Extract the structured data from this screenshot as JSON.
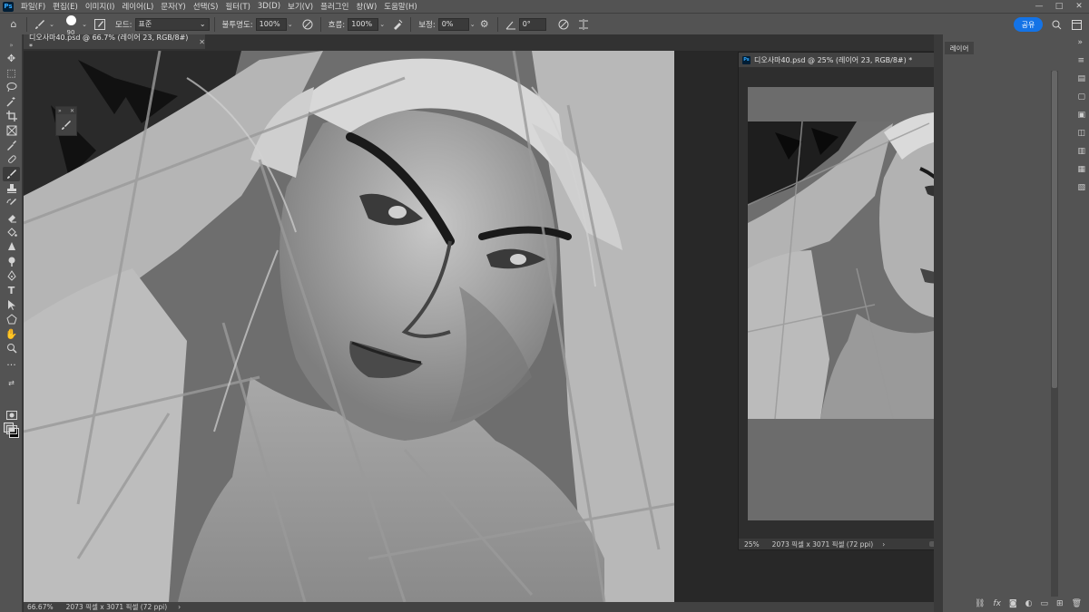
{
  "menu": {
    "items": [
      "파일(F)",
      "편집(E)",
      "이미지(I)",
      "레이어(L)",
      "문자(Y)",
      "선택(S)",
      "필터(T)",
      "3D(D)",
      "보기(V)",
      "플러그인",
      "창(W)",
      "도움말(H)"
    ],
    "logo": "Ps"
  },
  "window_controls": {
    "minimize": "—",
    "maximize": "□",
    "close": "✕"
  },
  "options": {
    "brush_size": "90",
    "mode_label": "모드:",
    "mode_value": "표준",
    "opacity_label": "불투명도:",
    "opacity_value": "100%",
    "flow_label": "흐름:",
    "flow_value": "100%",
    "smoothing_label": "보정:",
    "smoothing_value": "0%",
    "angle_value": "0°",
    "share_label": "공유"
  },
  "document": {
    "tab_title": "디오사마40.psd @ 66.7% (레이어 23, RGB/8#) *",
    "tab_close": "✕",
    "zoom": "66.67%",
    "dimensions": "2073 픽셀 x 3071 픽셀 (72 ppi)"
  },
  "floating_window": {
    "title": "디오사마40.psd @ 25% (레이어 23, RGB/8#) *",
    "zoom": "25%",
    "dimensions": "2073 픽셀 x 3071 픽셀 (72 ppi)"
  },
  "right_panel": {
    "tab_label": "레이어"
  },
  "colors": {
    "accent": "#1473e6",
    "panel_bg": "#535353",
    "workspace_bg": "#282828",
    "foreground_swatch": "#6a6a6a",
    "background_swatch": "#000000"
  },
  "icons": {
    "toolbar": [
      "move-icon",
      "marquee-icon",
      "lasso-icon",
      "magic-wand-icon",
      "crop-icon",
      "frame-icon",
      "eyedropper-icon",
      "healing-icon",
      "brush-icon",
      "stamp-icon",
      "history-brush-icon",
      "eraser-icon",
      "gradient-icon",
      "blur-icon",
      "dodge-icon",
      "pen-icon",
      "type-icon",
      "path-select-icon",
      "shape-icon",
      "hand-icon",
      "zoom-icon",
      "more-icon"
    ]
  }
}
